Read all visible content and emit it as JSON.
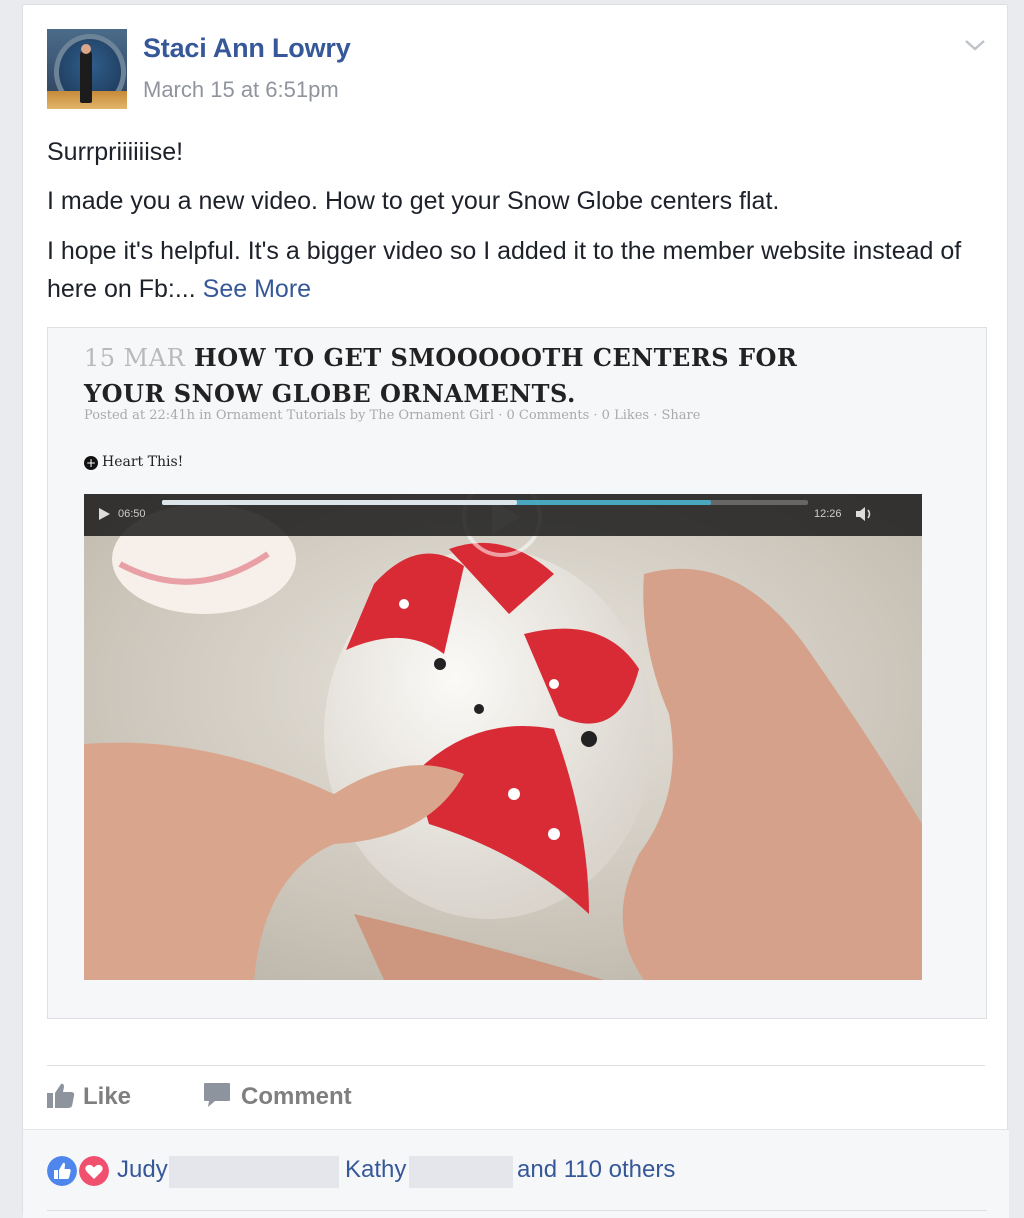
{
  "post": {
    "author": "Staci Ann Lowry",
    "timestamp": "March 15 at 6:51pm",
    "line1": "Surrpriiiiiise!",
    "line2": "I made you a new video. How to get your Snow Globe centers flat.",
    "line3": "I hope it's helpful. It's a bigger video so I added it to the member website instead of here on Fb:...",
    "see_more": "See More"
  },
  "article": {
    "date": "15 MAR",
    "title": "HOW TO GET SMOOOOOTH CENTERS FOR YOUR SNOW GLOBE ORNAMENTS.",
    "meta": "Posted at 22:41h in Ornament Tutorials by The Ornament Girl · 0 Comments · 0 Likes · Share",
    "heart_label": "Heart This!"
  },
  "video": {
    "current_time": "06:50",
    "duration": "12:26",
    "progress": 0.55,
    "buffered": 0.85
  },
  "actions": {
    "like": "Like",
    "comment": "Comment"
  },
  "reactions": {
    "name1": "Judy",
    "name2": "Kathy",
    "others": "and 110 others"
  },
  "colors": {
    "link_blue": "#365899",
    "like_blue": "#4f86ec",
    "love_red": "#f0506e"
  }
}
